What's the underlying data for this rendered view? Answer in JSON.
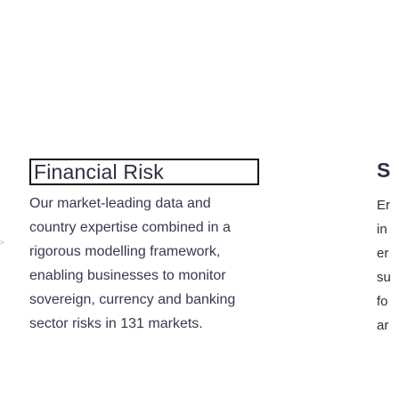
{
  "left_fragment": ">",
  "card": {
    "title": "Financial Risk",
    "body": "Our market-leading data and country expertise combined in a rigorous modelling framework, enabling businesses to monitor sovereign, currency and banking sector risks in 131 markets."
  },
  "right_column": {
    "title_fragment": "S",
    "line_fragments": [
      "Er",
      "in",
      "er",
      "su",
      "fo",
      "ar"
    ]
  }
}
